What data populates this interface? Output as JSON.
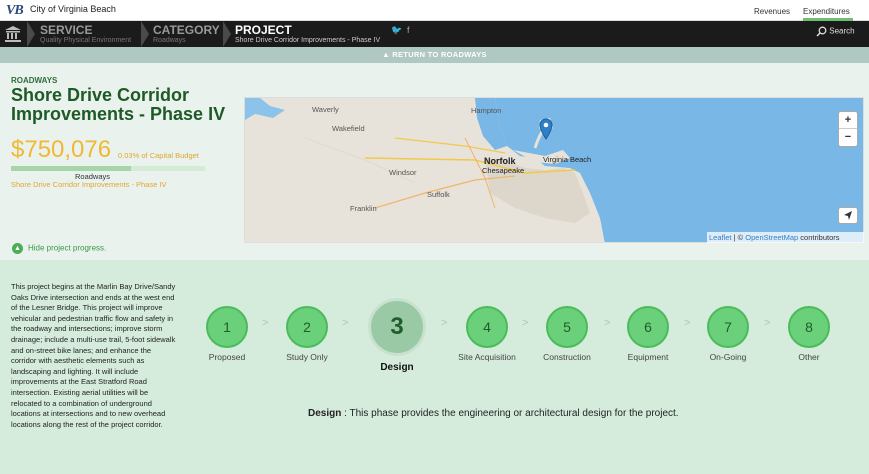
{
  "header": {
    "logo_text": "VB",
    "city_name": "City of Virginia Beach",
    "nav": {
      "revenues": "Revenues",
      "expenditures": "Expenditures"
    }
  },
  "breadcrumbs": [
    {
      "title": "SERVICE",
      "subtitle": "Quality Physical Environment"
    },
    {
      "title": "CATEGORY",
      "subtitle": "Roadways"
    },
    {
      "title": "PROJECT",
      "subtitle": "Shore Drive Corridor Improvements - Phase IV"
    }
  ],
  "social": {
    "twitter": "🐦",
    "facebook": "f"
  },
  "search_label": "Search",
  "return_label": "RETURN TO ROADWAYS",
  "project": {
    "category": "ROADWAYS",
    "title": "Shore Drive Corridor Improvements - Phase IV",
    "amount": "$750,076",
    "pct_label": "0.03% of Capital Budget",
    "bar_fraction": 0.62,
    "bar_label": "Roadways",
    "bar_sub": "Shore Drive Corridor Improvements - Phase IV",
    "hide_progress": "Hide project progress."
  },
  "map": {
    "places": {
      "waverly": "Waverly",
      "hampton": "Hampton",
      "wakefield": "Wakefield",
      "norfolk": "Norfolk",
      "virginia_beach": "Virginia Beach",
      "chesapeake": "Chesapeake",
      "windsor": "Windsor",
      "suffolk": "Suffolk",
      "franklin": "Franklin"
    },
    "zoom_in": "+",
    "zoom_out": "−",
    "attribution": {
      "leaflet": "Leaflet",
      "sep": " | © ",
      "osm": "OpenStreetMap",
      "contributors": " contributors"
    }
  },
  "description": "This project begins at the Marlin Bay Drive/Sandy Oaks Drive intersection and ends at the west end of the Lesner Bridge. This project will improve vehicular and pedestrian traffic flow and safety in the roadway and intersections; improve storm drainage; include a multi-use trail, 5-foot sidewalk and on-street bike lanes; and enhance the corridor with aesthetic elements such as landscaping and lighting. It will include improvements at the East Stratford Road intersection. Existing aerial utilities will be relocated to a combination of underground locations at intersections and to new overhead locations along the rest of the project corridor.",
  "steps": [
    {
      "num": "1",
      "label": "Proposed"
    },
    {
      "num": "2",
      "label": "Study Only"
    },
    {
      "num": "3",
      "label": "Design"
    },
    {
      "num": "4",
      "label": "Site Acquisition"
    },
    {
      "num": "5",
      "label": "Construction"
    },
    {
      "num": "6",
      "label": "Equipment"
    },
    {
      "num": "7",
      "label": "On-Going"
    },
    {
      "num": "8",
      "label": "Other"
    }
  ],
  "separator": ">",
  "phase": {
    "name": "Design",
    "separator": " : ",
    "text": "This phase provides the engineering or architectural design for the project."
  },
  "colors": {
    "accent_green": "#6ad07a",
    "amount_gold": "#f2b733",
    "title_green": "#1d5a26",
    "water": "#78b7e6"
  }
}
